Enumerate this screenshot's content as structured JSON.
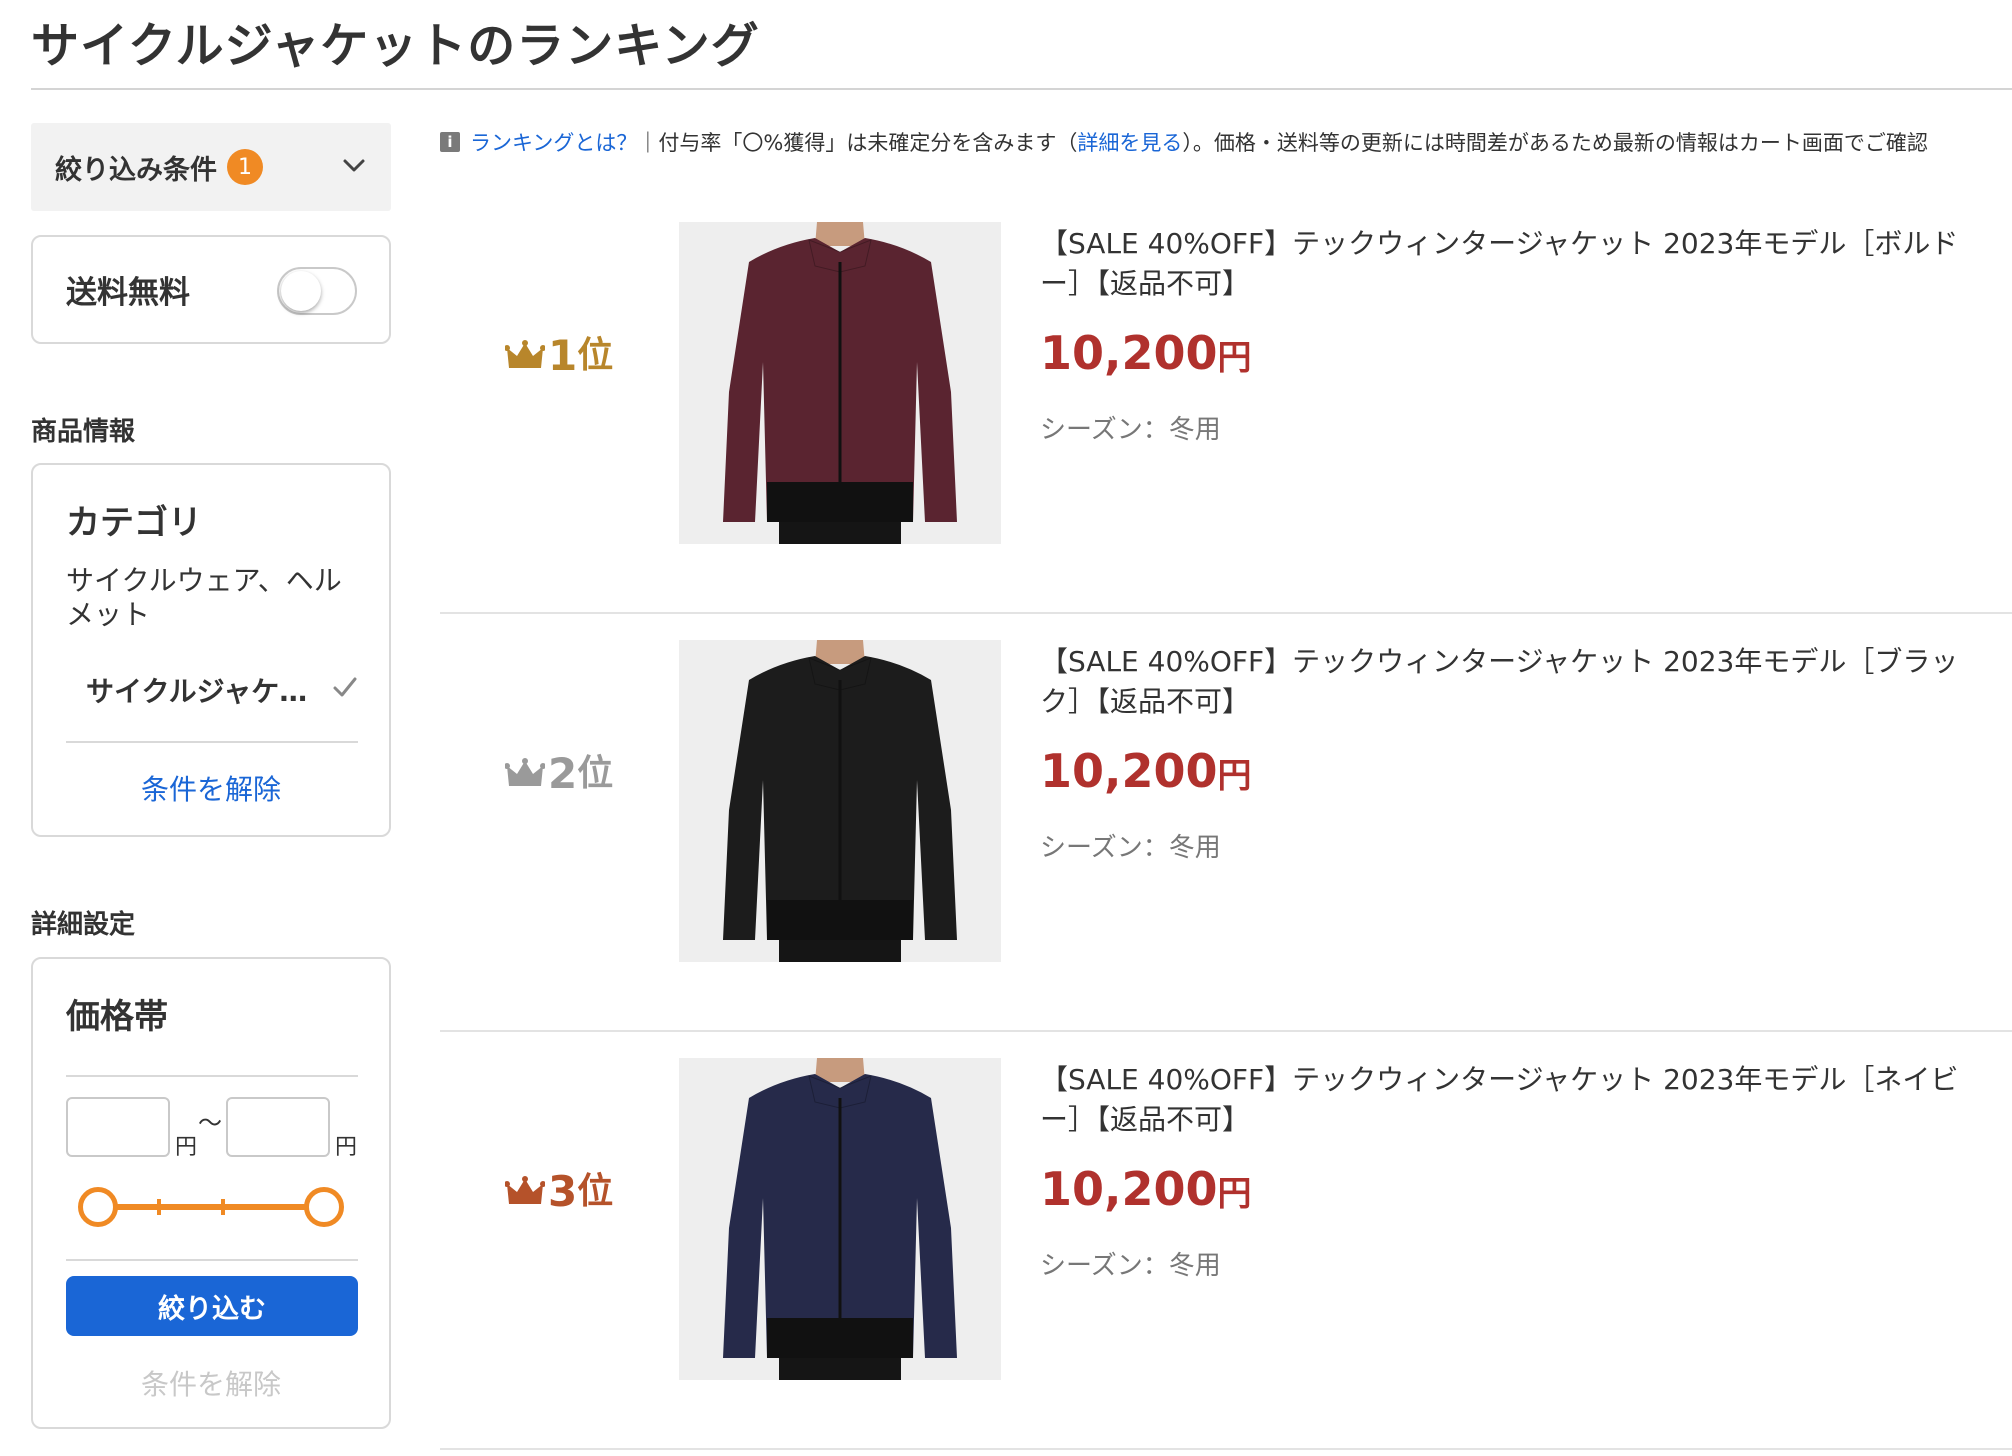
{
  "page": {
    "title": "サイクルジャケットのランキング"
  },
  "sidebar": {
    "filter_header": {
      "label": "絞り込み条件",
      "badge_count": "1",
      "chevron_icon": "chevron-down-icon"
    },
    "free_shipping": {
      "label": "送料無料",
      "toggle_on": false
    },
    "product_info_heading": "商品情報",
    "category": {
      "title": "カテゴリ",
      "parent": "サイクルウェア、ヘルメット",
      "selected": "サイクルジャケット",
      "clear_label": "条件を解除"
    },
    "detail_heading": "詳細設定",
    "price_range": {
      "title": "価格帯",
      "min_placeholder": "",
      "max_placeholder": "",
      "yen_unit": "円",
      "tilde": "〜",
      "slider_min_fraction": 0,
      "slider_max_fraction": 1,
      "apply_label": "絞り込む",
      "clear_label": "条件を解除"
    }
  },
  "notice": {
    "info_icon": "i",
    "what_is_ranking": "ランキングとは？",
    "text1": "｜付与率「〇%獲得」は未確定分を含みます（",
    "detail_link": "詳細を見る",
    "text2": "）。価格・送料等の更新には時間差があるため最新の情報はカート画面でご確認"
  },
  "items": [
    {
      "rank_num": "1",
      "rank_suffix": "位",
      "crown_color": "#b8862b",
      "title": "【SALE 40%OFF】テックウィンタージャケット 2023年モデル［ボルドー］【返品不可】",
      "price": "10,200",
      "price_unit": "円",
      "season": "シーズン：冬用",
      "jacket_color": "#5a2430"
    },
    {
      "rank_num": "2",
      "rank_suffix": "位",
      "crown_color": "#9a9a9a",
      "title": "【SALE 40%OFF】テックウィンタージャケット 2023年モデル［ブラック］【返品不可】",
      "price": "10,200",
      "price_unit": "円",
      "season": "シーズン：冬用",
      "jacket_color": "#1c1c1c"
    },
    {
      "rank_num": "3",
      "rank_suffix": "位",
      "crown_color": "#b5522a",
      "title": "【SALE 40%OFF】テックウィンタージャケット 2023年モデル［ネイビー］【返品不可】",
      "price": "10,200",
      "price_unit": "円",
      "season": "シーズン：冬用",
      "jacket_color": "#262a4a"
    }
  ]
}
